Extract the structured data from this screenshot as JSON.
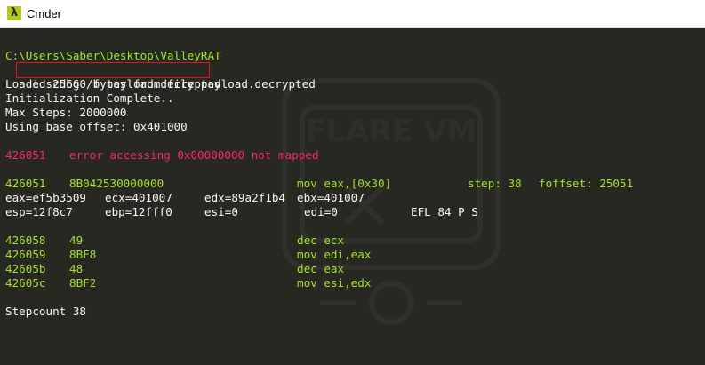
{
  "window": {
    "title": "Cmder",
    "icon": "lambda-icon"
  },
  "terminal": {
    "prompt_path": "C:\\Users\\Saber\\Desktop\\ValleyRAT",
    "prompt_symbol": "λ",
    "command": "scdbg /f payload.decrypted",
    "output": [
      "Loaded 25660 bytes from file payload.decrypted",
      "Initialization Complete..",
      "Max Steps: 2000000",
      "Using base offset: 0x401000"
    ],
    "error": {
      "addr": "426051",
      "message": "error accessing 0x00000000 not mapped"
    },
    "step_line": {
      "addr": "426051",
      "bytes": "8B042530000000",
      "instr": "mov eax,[0x30]",
      "step": "step: 38",
      "foffset": "foffset: 25051"
    },
    "registers_1": {
      "eax": "eax=ef5b3509",
      "ecx": "ecx=401007",
      "edx": "edx=89a2f1b4",
      "ebx": "ebx=401007"
    },
    "registers_2": {
      "esp": "esp=12f8c7",
      "ebp": "ebp=12fff0",
      "esi": "esi=0",
      "edi": "edi=0",
      "efl": "EFL 84 P S"
    },
    "disasm": [
      {
        "addr": "426058",
        "bytes": "49",
        "instr": "dec ecx"
      },
      {
        "addr": "426059",
        "bytes": "8BF8",
        "instr": "mov edi,eax"
      },
      {
        "addr": "42605b",
        "bytes": "48",
        "instr": "dec eax"
      },
      {
        "addr": "42605c",
        "bytes": "8BF2",
        "instr": "mov esi,edx"
      }
    ],
    "stepcount": "Stepcount 38"
  },
  "watermark": {
    "text": "FLARE VM"
  },
  "colors": {
    "background": "#272822",
    "text": "#f8f8f2",
    "green": "#a6e22e",
    "red": "#f92672",
    "highlight_box": "#e81123"
  }
}
